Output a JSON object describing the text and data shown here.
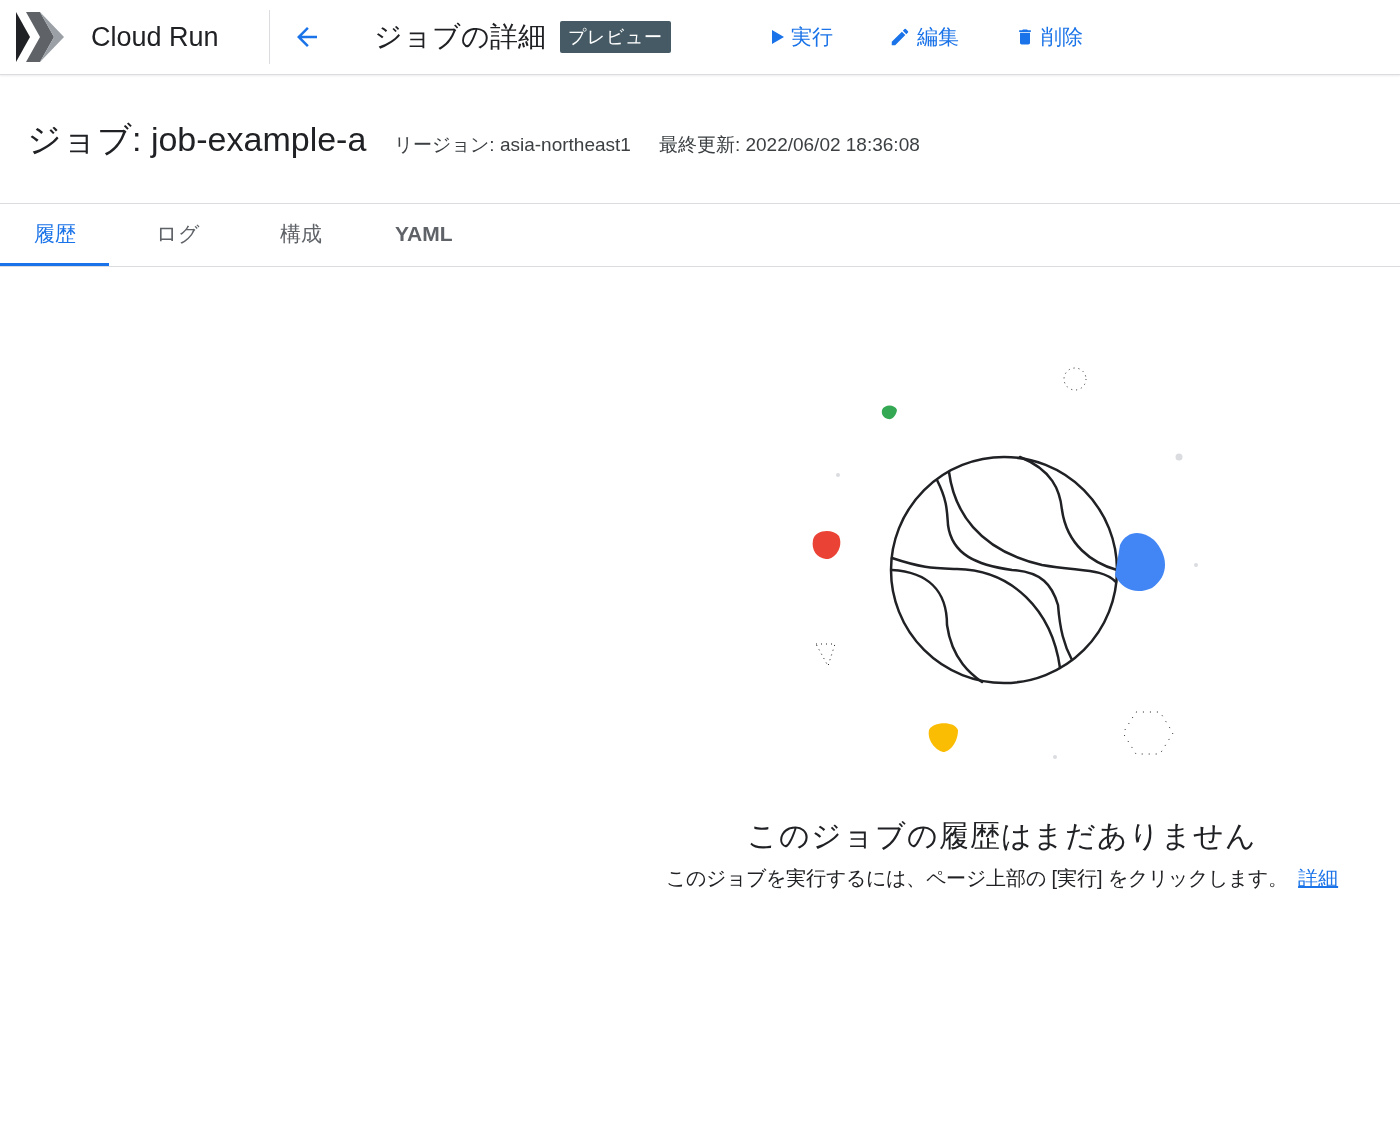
{
  "app": {
    "name": "Cloud Run"
  },
  "header": {
    "title": "ジョブの詳細",
    "badge": "プレビュー",
    "actions": [
      {
        "kind": "run",
        "label": "実行"
      },
      {
        "kind": "edit",
        "label": "編集"
      },
      {
        "kind": "delete",
        "label": "削除"
      }
    ]
  },
  "job": {
    "title": "ジョブ: job-example-a",
    "region": "リージョン: asia-northeast1",
    "updated": "最終更新: 2022/06/02 18:36:08"
  },
  "tabs": [
    {
      "label": "履歴",
      "selected": true
    },
    {
      "label": "ログ",
      "selected": false
    },
    {
      "label": "構成",
      "selected": false
    },
    {
      "label": "YAML",
      "selected": false
    }
  ],
  "empty_state": {
    "title": "このジョブの履歴はまだありません",
    "description": "このジョブを実行するには、ページ上部の [実行] をクリックします。",
    "link": "詳細"
  }
}
